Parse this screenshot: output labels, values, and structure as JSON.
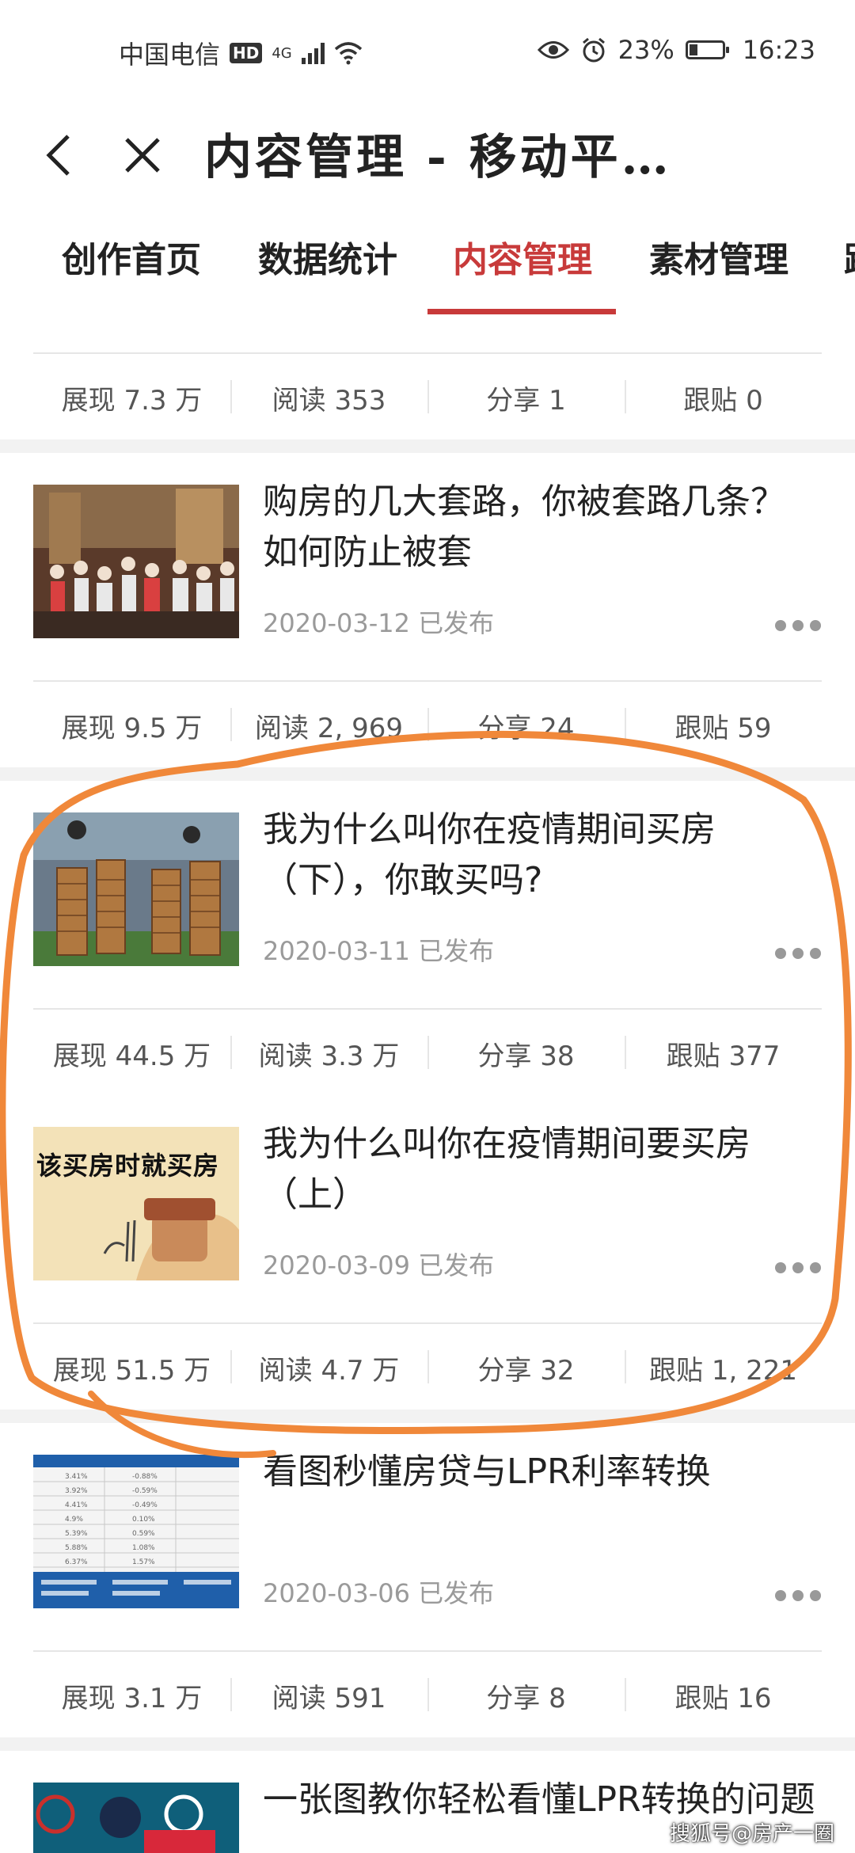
{
  "status_bar": {
    "carrier": "中国电信",
    "hd": "HD",
    "network": "4G",
    "battery": "23%",
    "battery_level": 0.23,
    "time": "16:23"
  },
  "title_bar": {
    "title": "内容管理 - 移动平…"
  },
  "tabs": [
    {
      "label": "创作首页"
    },
    {
      "label": "数据统计"
    },
    {
      "label": "内容管理",
      "active": true
    },
    {
      "label": "素材管理"
    },
    {
      "label": "跟"
    }
  ],
  "articles": [
    {
      "title": "",
      "date": "",
      "stats": [
        "展现 7.3 万",
        "阅读 353",
        "分享 1",
        "跟贴 0"
      ]
    },
    {
      "title": "购房的几大套路，你被套路几条？如何防止被套",
      "date": "2020-03-12 已发布",
      "stats": [
        "展现 9.5 万",
        "阅读 2, 969",
        "分享 24",
        "跟贴 59"
      ]
    },
    {
      "title": "我为什么叫你在疫情期间买房（下），你敢买吗?",
      "date": "2020-03-11 已发布",
      "stats": [
        "展现 44.5 万",
        "阅读 3.3 万",
        "分享 38",
        "跟贴 377"
      ]
    },
    {
      "title": "我为什么叫你在疫情期间要买房（上）",
      "date": "2020-03-09 已发布",
      "thumb_text": "该买房时就买房",
      "stats": [
        "展现 51.5 万",
        "阅读 4.7 万",
        "分享 32",
        "跟贴 1, 221"
      ]
    },
    {
      "title": "看图秒懂房贷与LPR利率转换",
      "date": "2020-03-06 已发布",
      "stats": [
        "展现 3.1 万",
        "阅读 591",
        "分享 8",
        "跟贴 16"
      ]
    },
    {
      "title": "一张图教你轻松看懂LPR转换的问题",
      "date": ""
    }
  ],
  "watermark": "搜狐号@房产一圈",
  "colors": {
    "accent": "#c83a3a",
    "annotation": "#f0883a"
  }
}
